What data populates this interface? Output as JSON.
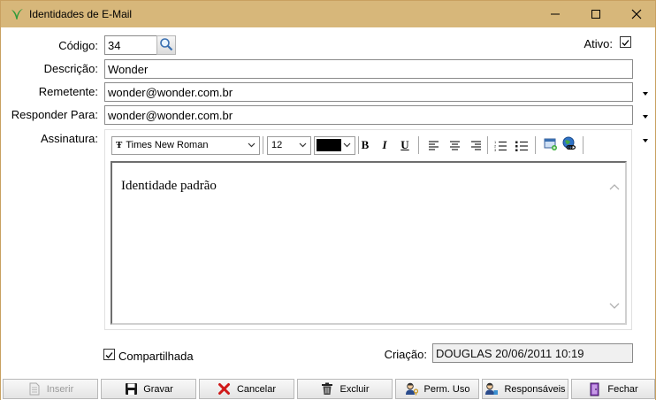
{
  "window": {
    "title": "Identidades de E-Mail"
  },
  "form": {
    "codigo_label": "Código:",
    "codigo_value": "34",
    "ativo_label": "Ativo:",
    "descricao_label": "Descrição:",
    "descricao_value": "Wonder",
    "remetente_label": "Remetente:",
    "remetente_value": "wonder@wonder.com.br",
    "responder_label": "Responder Para:",
    "responder_value": "wonder@wonder.com.br",
    "assinatura_label": "Assinatura:",
    "compartilhada_label": "Compartilhada",
    "criacao_label": "Criação:",
    "criacao_value": "DOUGLAS 20/06/2011 10:19"
  },
  "editor": {
    "font_name": "Times New Roman",
    "font_size": "12",
    "color": "#000000",
    "content": "Identidade padrão"
  },
  "footer": {
    "inserir": "Inserir",
    "gravar": "Gravar",
    "cancelar": "Cancelar",
    "excluir": "Excluir",
    "perm_uso": "Perm. Uso",
    "responsaveis": "Responsáveis",
    "fechar": "Fechar"
  }
}
